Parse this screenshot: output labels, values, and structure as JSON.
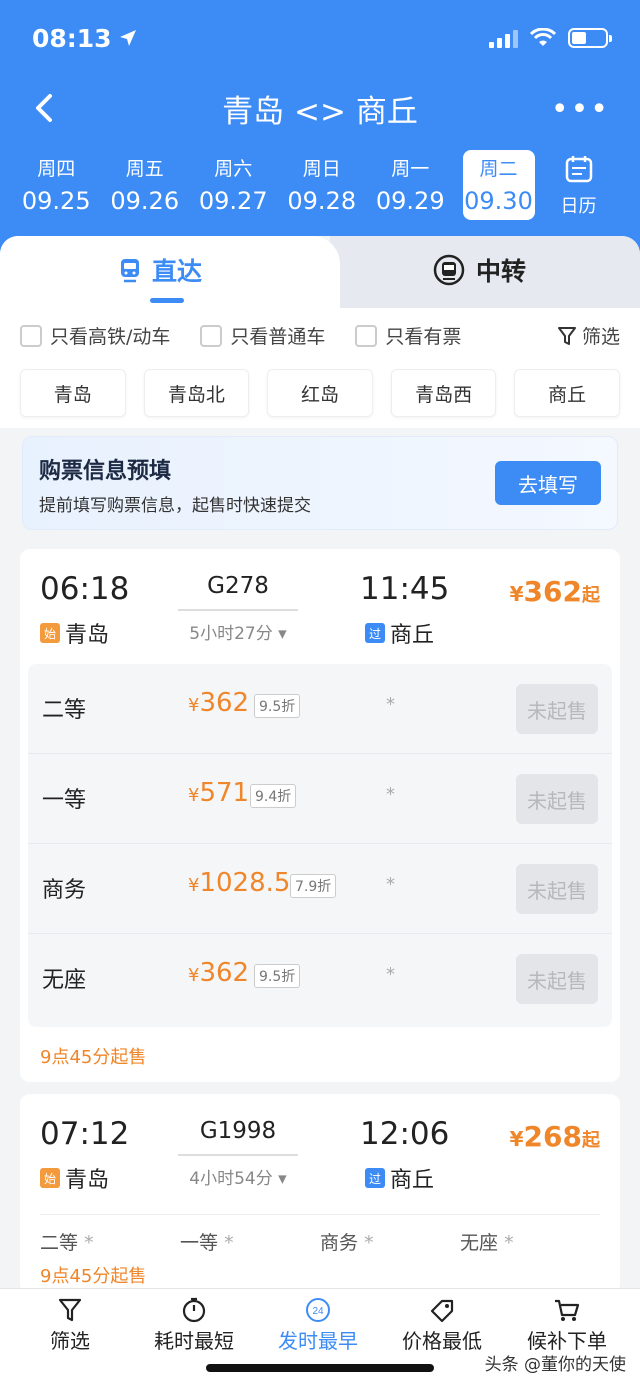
{
  "status": {
    "time": "08:13"
  },
  "nav": {
    "title": "青岛 <> 商丘",
    "more": "•••"
  },
  "dates": [
    {
      "weekday": "周四",
      "date": "09.25"
    },
    {
      "weekday": "周五",
      "date": "09.26"
    },
    {
      "weekday": "周六",
      "date": "09.27"
    },
    {
      "weekday": "周日",
      "date": "09.28"
    },
    {
      "weekday": "周一",
      "date": "09.29"
    },
    {
      "weekday": "周二",
      "date": "09.30",
      "active": true
    }
  ],
  "calendar": {
    "label": "日历"
  },
  "tabs": {
    "direct": "直达",
    "transfer": "中转"
  },
  "filters": {
    "high_speed": "只看高铁/动车",
    "normal": "只看普通车",
    "has_ticket": "只看有票",
    "filter": "筛选"
  },
  "stations": [
    "青岛",
    "青岛北",
    "红岛",
    "青岛西",
    "商丘"
  ],
  "prefill": {
    "title": "购票信息预填",
    "subtitle": "提前填写购票信息，起售时快速提交",
    "button": "去填写"
  },
  "trains": [
    {
      "depart_time": "06:18",
      "arrive_time": "11:45",
      "train_no": "G278",
      "duration": "5小时27分",
      "depart_station": "青岛",
      "arrive_station": "商丘",
      "start_badge": "始",
      "pass_badge": "过",
      "price": "362",
      "price_suffix": "起",
      "seats": [
        {
          "name": "二等",
          "price": "362",
          "discount": "9.5折",
          "avail": "*",
          "button": "未起售"
        },
        {
          "name": "一等",
          "price": "571",
          "discount": "9.4折",
          "avail": "*",
          "button": "未起售"
        },
        {
          "name": "商务",
          "price": "1028.5",
          "discount": "7.9折",
          "avail": "*",
          "button": "未起售"
        },
        {
          "name": "无座",
          "price": "362",
          "discount": "9.5折",
          "avail": "*",
          "button": "未起售"
        }
      ],
      "sale_note": "9点45分起售"
    },
    {
      "depart_time": "07:12",
      "arrive_time": "12:06",
      "train_no": "G1998",
      "duration": "4小时54分",
      "depart_station": "青岛",
      "arrive_station": "商丘",
      "start_badge": "始",
      "pass_badge": "过",
      "price": "268",
      "price_suffix": "起",
      "seat_summary": [
        {
          "name": "二等",
          "avail": "*"
        },
        {
          "name": "一等",
          "avail": "*"
        },
        {
          "name": "商务",
          "avail": "*"
        },
        {
          "name": "无座",
          "avail": "*"
        }
      ],
      "sale_note": "9点45分起售"
    }
  ],
  "currency": "¥",
  "bottombar": {
    "filter": "筛选",
    "shortest": "耗时最短",
    "earliest": "发时最早",
    "cheapest": "价格最低",
    "waitlist": "候补下单",
    "earliest_badge": "24"
  },
  "watermark": "头条 @董你的天使",
  "colors": {
    "primary": "#3d8cf5",
    "price": "#f0862a"
  }
}
